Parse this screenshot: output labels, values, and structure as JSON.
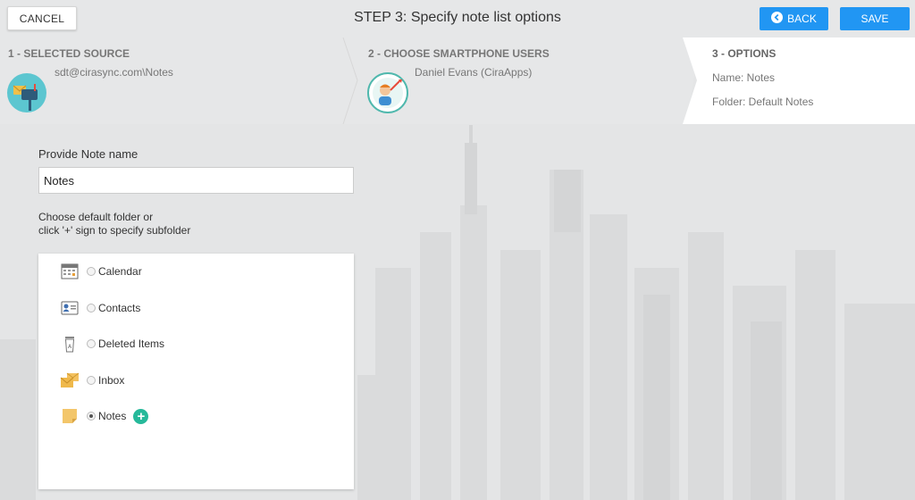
{
  "header": {
    "cancel_label": "CANCEL",
    "title": "STEP 3: Specify note list options",
    "back_label": "BACK",
    "save_label": "SAVE"
  },
  "steps": [
    {
      "title": "1 - SELECTED SOURCE",
      "lines": [
        "sdt@cirasync.com\\Notes"
      ],
      "icon": "mailbox-icon"
    },
    {
      "title": "2 - CHOOSE SMARTPHONE USERS",
      "lines": [
        "Daniel Evans (CiraApps)"
      ],
      "icon": "user-target-icon"
    },
    {
      "title": "3 - OPTIONS",
      "lines": [
        "Name: Notes",
        "Folder: Default Notes"
      ],
      "active": true
    }
  ],
  "form": {
    "name_label": "Provide Note name",
    "name_value": "Notes",
    "folder_help_line1": "Choose default folder or",
    "folder_help_line2": "click '+' sign to specify subfolder"
  },
  "folders": [
    {
      "label": "Calendar",
      "icon": "calendar-icon",
      "selected": false
    },
    {
      "label": "Contacts",
      "icon": "contact-card-icon",
      "selected": false
    },
    {
      "label": "Deleted Items",
      "icon": "trash-icon",
      "selected": false
    },
    {
      "label": "Inbox",
      "icon": "inbox-envelopes-icon",
      "selected": false
    },
    {
      "label": "Notes",
      "icon": "sticky-note-icon",
      "selected": true,
      "add_label": "+"
    }
  ],
  "colors": {
    "accent": "#2196f3",
    "add_button": "#26b99a",
    "active_step": "#ffffff"
  }
}
